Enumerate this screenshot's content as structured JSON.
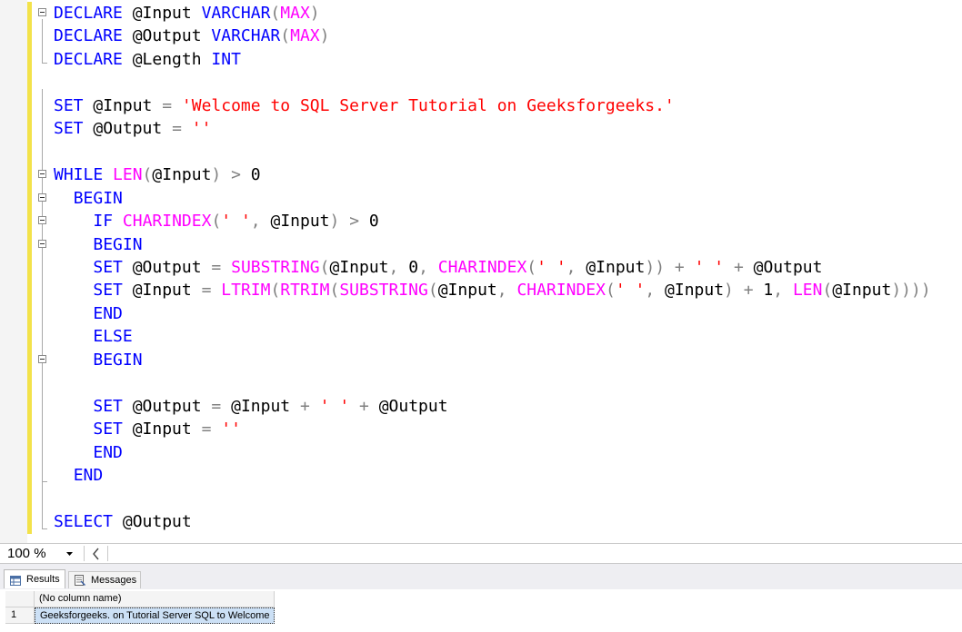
{
  "editor": {
    "lines": [
      [
        [
          "kw",
          "DECLARE"
        ],
        [
          "id",
          " @Input "
        ],
        [
          "kw",
          "VARCHAR"
        ],
        [
          "op",
          "("
        ],
        [
          "fn",
          "MAX"
        ],
        [
          "op",
          ")"
        ]
      ],
      [
        [
          "kw",
          "DECLARE"
        ],
        [
          "id",
          " @Output "
        ],
        [
          "kw",
          "VARCHAR"
        ],
        [
          "op",
          "("
        ],
        [
          "fn",
          "MAX"
        ],
        [
          "op",
          ")"
        ]
      ],
      [
        [
          "kw",
          "DECLARE"
        ],
        [
          "id",
          " @Length "
        ],
        [
          "kw",
          "INT"
        ]
      ],
      [],
      [
        [
          "kw",
          "SET"
        ],
        [
          "id",
          " @Input "
        ],
        [
          "op",
          "="
        ],
        [
          "id",
          " "
        ],
        [
          "st",
          "'Welcome to SQL Server Tutorial on Geeksforgeeks.'"
        ]
      ],
      [
        [
          "kw",
          "SET"
        ],
        [
          "id",
          " @Output "
        ],
        [
          "op",
          "="
        ],
        [
          "id",
          " "
        ],
        [
          "st",
          "''"
        ]
      ],
      [],
      [
        [
          "kw",
          "WHILE"
        ],
        [
          "id",
          " "
        ],
        [
          "fn",
          "LEN"
        ],
        [
          "op",
          "("
        ],
        [
          "id",
          "@Input"
        ],
        [
          "op",
          ")"
        ],
        [
          "id",
          " "
        ],
        [
          "op",
          ">"
        ],
        [
          "id",
          " 0"
        ]
      ],
      [
        [
          "id",
          "  "
        ],
        [
          "kw",
          "BEGIN"
        ]
      ],
      [
        [
          "id",
          "    "
        ],
        [
          "kw",
          "IF"
        ],
        [
          "id",
          " "
        ],
        [
          "fn",
          "CHARINDEX"
        ],
        [
          "op",
          "("
        ],
        [
          "st",
          "' '"
        ],
        [
          "op",
          ","
        ],
        [
          "id",
          " @Input"
        ],
        [
          "op",
          ")"
        ],
        [
          "id",
          " "
        ],
        [
          "op",
          ">"
        ],
        [
          "id",
          " 0"
        ]
      ],
      [
        [
          "id",
          "    "
        ],
        [
          "kw",
          "BEGIN"
        ]
      ],
      [
        [
          "id",
          "    "
        ],
        [
          "kw",
          "SET"
        ],
        [
          "id",
          " @Output "
        ],
        [
          "op",
          "="
        ],
        [
          "id",
          " "
        ],
        [
          "fn",
          "SUBSTRING"
        ],
        [
          "op",
          "("
        ],
        [
          "id",
          "@Input"
        ],
        [
          "op",
          ","
        ],
        [
          "id",
          " 0"
        ],
        [
          "op",
          ","
        ],
        [
          "id",
          " "
        ],
        [
          "fn",
          "CHARINDEX"
        ],
        [
          "op",
          "("
        ],
        [
          "st",
          "' '"
        ],
        [
          "op",
          ","
        ],
        [
          "id",
          " @Input"
        ],
        [
          "op",
          "))"
        ],
        [
          "id",
          " "
        ],
        [
          "op",
          "+"
        ],
        [
          "id",
          " "
        ],
        [
          "st",
          "' '"
        ],
        [
          "id",
          " "
        ],
        [
          "op",
          "+"
        ],
        [
          "id",
          " @Output"
        ]
      ],
      [
        [
          "id",
          "    "
        ],
        [
          "kw",
          "SET"
        ],
        [
          "id",
          " @Input "
        ],
        [
          "op",
          "="
        ],
        [
          "id",
          " "
        ],
        [
          "fn",
          "LTRIM"
        ],
        [
          "op",
          "("
        ],
        [
          "fn",
          "RTRIM"
        ],
        [
          "op",
          "("
        ],
        [
          "fn",
          "SUBSTRING"
        ],
        [
          "op",
          "("
        ],
        [
          "id",
          "@Input"
        ],
        [
          "op",
          ","
        ],
        [
          "id",
          " "
        ],
        [
          "fn",
          "CHARINDEX"
        ],
        [
          "op",
          "("
        ],
        [
          "st",
          "' '"
        ],
        [
          "op",
          ","
        ],
        [
          "id",
          " @Input"
        ],
        [
          "op",
          ")"
        ],
        [
          "id",
          " "
        ],
        [
          "op",
          "+"
        ],
        [
          "id",
          " 1"
        ],
        [
          "op",
          ","
        ],
        [
          "id",
          " "
        ],
        [
          "fn",
          "LEN"
        ],
        [
          "op",
          "("
        ],
        [
          "id",
          "@Input"
        ],
        [
          "op",
          "))))"
        ]
      ],
      [
        [
          "id",
          "    "
        ],
        [
          "kw",
          "END"
        ]
      ],
      [
        [
          "id",
          "    "
        ],
        [
          "kw",
          "ELSE"
        ]
      ],
      [
        [
          "id",
          "    "
        ],
        [
          "kw",
          "BEGIN"
        ]
      ],
      [],
      [
        [
          "id",
          "    "
        ],
        [
          "kw",
          "SET"
        ],
        [
          "id",
          " @Output "
        ],
        [
          "op",
          "="
        ],
        [
          "id",
          " @Input "
        ],
        [
          "op",
          "+"
        ],
        [
          "id",
          " "
        ],
        [
          "st",
          "' '"
        ],
        [
          "id",
          " "
        ],
        [
          "op",
          "+"
        ],
        [
          "id",
          " @Output"
        ]
      ],
      [
        [
          "id",
          "    "
        ],
        [
          "kw",
          "SET"
        ],
        [
          "id",
          " @Input "
        ],
        [
          "op",
          "="
        ],
        [
          "id",
          " "
        ],
        [
          "st",
          "''"
        ]
      ],
      [
        [
          "id",
          "    "
        ],
        [
          "kw",
          "END"
        ]
      ],
      [
        [
          "id",
          "  "
        ],
        [
          "kw",
          "END"
        ]
      ],
      [],
      [
        [
          "kw",
          "SELECT"
        ],
        [
          "id",
          " @Output"
        ]
      ]
    ],
    "colors": {
      "keyword": "#0000ff",
      "function": "#ff00ff",
      "string": "#ff0000",
      "operator": "#808080"
    }
  },
  "statusbar": {
    "zoom_value": "100 %",
    "zoom_dropdown_icon": "chevron-down-icon",
    "scroll_left_icon": "chevron-left-icon"
  },
  "results": {
    "tabs": [
      {
        "label": "Results",
        "icon": "grid-icon"
      },
      {
        "label": "Messages",
        "icon": "messages-icon"
      }
    ],
    "grid": {
      "columns": [
        "(No column name)"
      ],
      "rows": [
        {
          "row_number": "1",
          "values": [
            "Geeksforgeeks. on Tutorial Server SQL to Welcome"
          ]
        }
      ]
    }
  }
}
